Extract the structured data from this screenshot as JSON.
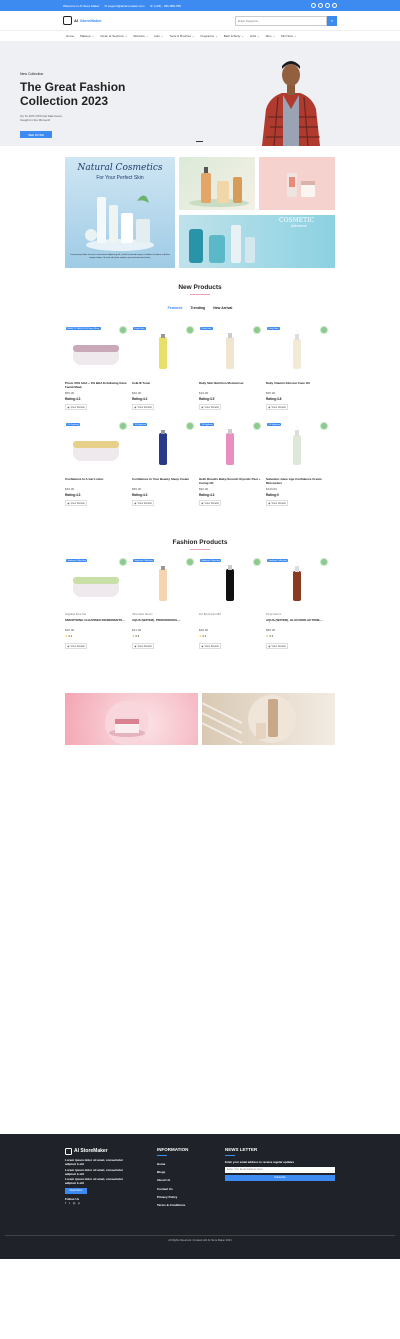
{
  "topbar": {
    "welcome": "Welcome to AI Store Maker",
    "email": "support@aistoremaker.com",
    "phone": "(123) - 456-868-789"
  },
  "header": {
    "logo_a": "AI",
    "logo_b": "StoreMaker",
    "search_placeholder": "Enter Keyword"
  },
  "nav": [
    "Home",
    "Makeup",
    "Clean at Sephora",
    "Skincare",
    "Hair",
    "Tools & Brushes",
    "Fragrance",
    "Bath & Body",
    "Gifts",
    "Men",
    "Mini Size"
  ],
  "hero": {
    "tag": "New Collection",
    "title": "The Great Fashion Collection 2023",
    "sub": "Up To 40% Off Final Sale Items. Caught in the Moment!",
    "button": "SEE MORE"
  },
  "banner": {
    "title": "Natural Cosmetics",
    "sub": "For Your Perfect Skin",
    "body": "Lorem ipsum dolor sit amet, consectetur adipiscing elit, sed do eiusmod tempor incididunt ut labore et dolore magna aliqua. Ut enim ad minim veniam, quis nostrud exercitation.",
    "right_title": "COSMETIC",
    "right_sub": "Adventure",
    "co": "CO"
  },
  "new_products": {
    "title": "New Products",
    "tabs": [
      "Featured",
      "Trending",
      "New Arrival"
    ],
    "view": "View Details",
    "items": [
      {
        "badge": "BEAUTY SALE 2024 Save Shop",
        "name": "Prism 30% AHA + 3% BHA Exfoliating Glow Facial Mask",
        "price": "$55.00",
        "rating": "Rating:4.3",
        "color": "#c9a8b8"
      },
      {
        "badge": "Daily Sale",
        "name": "CeB-III Toner",
        "price": "$40.00",
        "rating": "Rating:4.2",
        "color": "#e8e06a"
      },
      {
        "badge": "Daily Sale",
        "name": "Daily Skin Nutrition Moisturiser",
        "price": "$19.00",
        "rating": "Rating:3.5",
        "color": "#f0e6cf"
      },
      {
        "badge": "Daily Sale",
        "name": "Daily Vitamin Infusion Face Oil",
        "price": "$95.00",
        "rating": "Rating:3.8",
        "color": "#f2ead4"
      },
      {
        "badge": "15 Sephora",
        "name": "Confidence In A Gel Lotion",
        "price": "$46.00",
        "rating": "Rating:4.3",
        "color": "#e6d08a"
      },
      {
        "badge": "15 Sephora",
        "name": "Confidence In Your Beauty Sleep Cream",
        "price": "$65.00",
        "rating": "Rating:4.3",
        "color": "#2a3a8a"
      },
      {
        "badge": "15 Sephora",
        "name": "Hello Results Baby-Smooth Glycolic Peel + Caring Oil",
        "price": "$92.00",
        "rating": "Rating:4.3",
        "color": "#e98fc0"
      },
      {
        "badge": "15 Sephora",
        "name": "Salvation Juice Age Confidence Cream Moisturizer",
        "price": "$120.00",
        "rating": "Rating:0",
        "color": "#dfe8d8"
      }
    ]
  },
  "fashion_products": {
    "title": "Fashion Products",
    "view": "View Details",
    "items": [
      {
        "badge": "Sephora Collection",
        "brand": "Supplied Pure Set",
        "name": "SMOOTHING CLEANSER INGREDIENTS...",
        "price": "$40.00",
        "stars": "4.1",
        "color": "#c8e0a8"
      },
      {
        "badge": "Sephora Collection",
        "brand": "Ultra Glow Serum",
        "name": "AQUA (WATER), PROPANEDIOL,...",
        "price": "$21.00",
        "stars": "3.3",
        "color": "#f5d5b0"
      },
      {
        "badge": "Sephora Collection",
        "brand": "Pro Brush Fan #64",
        "name": "",
        "price": "$39.00",
        "stars": "3.1",
        "color": "#111111"
      },
      {
        "badge": "Sephora Collection",
        "brand": "Pump Serum",
        "name": "AQUA (WATER), GLUCONOLACTONE,...",
        "price": "$55.00",
        "stars": "3.1",
        "color": "#8a3a20"
      }
    ]
  },
  "footer": {
    "logo": "AI StoreMaker",
    "about": [
      "Lorem ipsum dolor sit amet, consectetur adipisci k elit",
      "Lorem ipsum dolor sit amet, consectetur adipisci k elit",
      "Lorem ipsum dolor sit amet, consectetur adipisci k elit"
    ],
    "read_more": "Read More",
    "follow": "Follow Us",
    "info_title": "INFORMATION",
    "links": [
      "Home",
      "Blogs",
      "About Us",
      "Contact Us",
      "Privacy Policy",
      "Terms & Conditions"
    ],
    "news_title": "NEWS LETTER",
    "news_text": "Enter your email address to receive regular updates",
    "news_placeholder": "Enter Your Email Address Here",
    "subscribe": "Subscribe",
    "copyright": "All Rights Reserved. Created with AI Store Maker 2023"
  },
  "colors": {
    "accent": "#3d8bf0",
    "footer": "#1f2228",
    "pink": "#e9a0b8"
  }
}
